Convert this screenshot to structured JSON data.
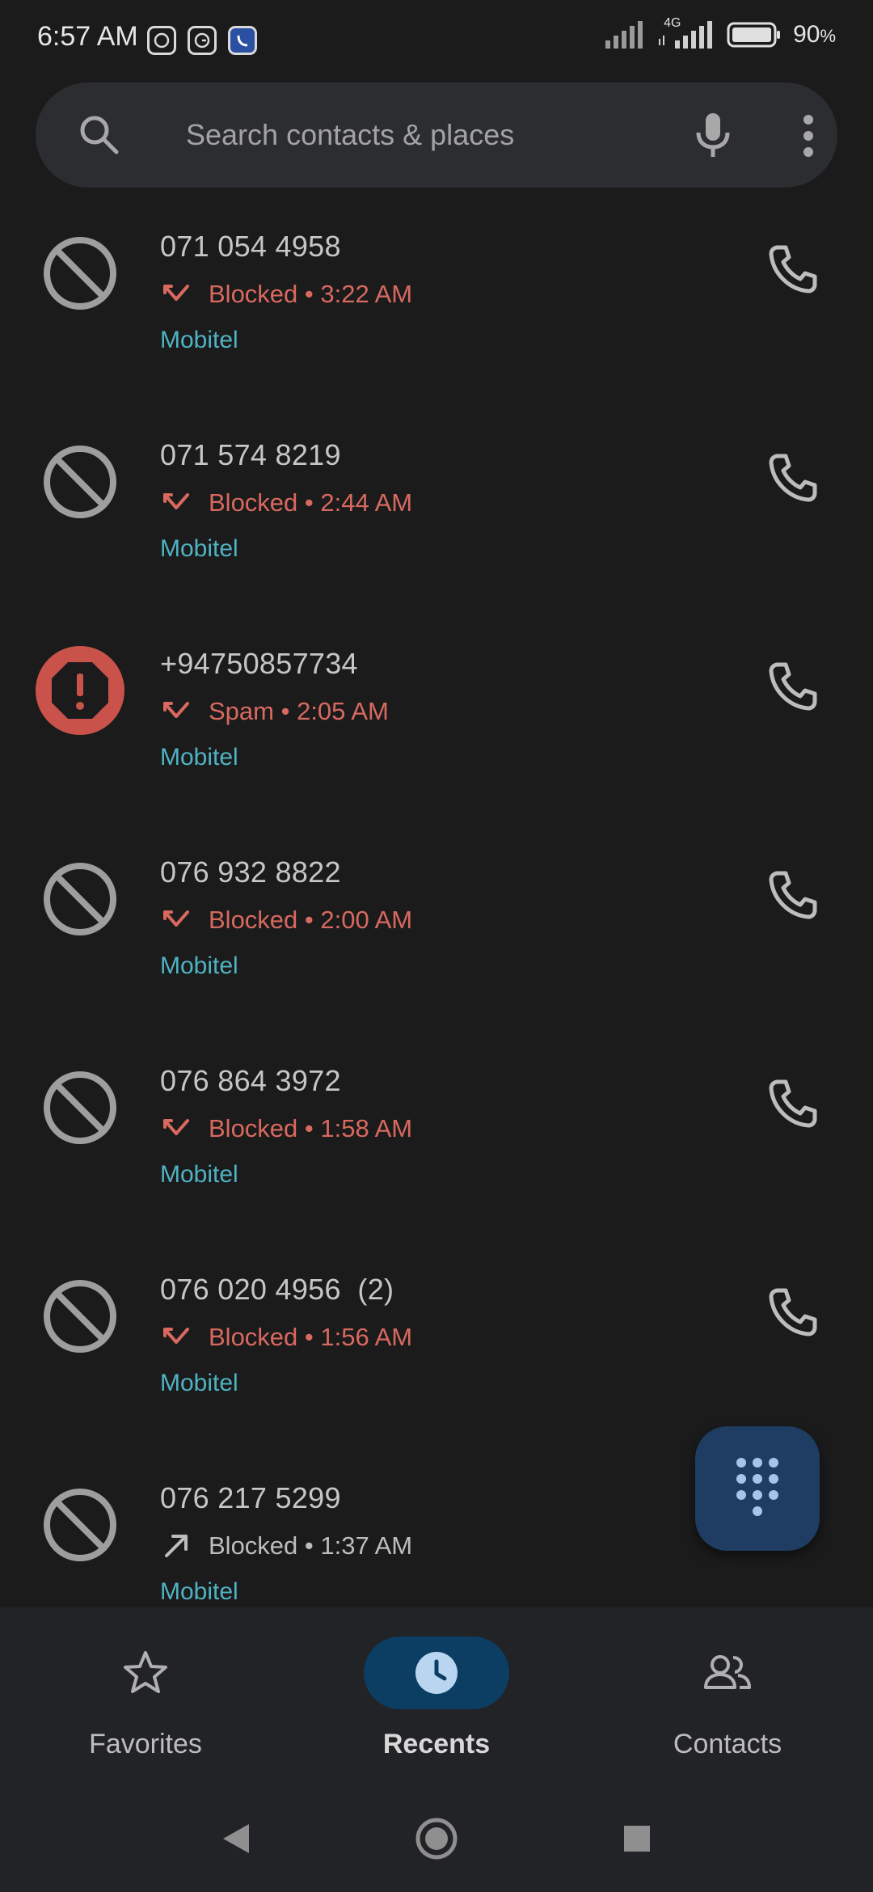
{
  "status_bar": {
    "time": "6:57 AM",
    "network": "4G",
    "battery": "90",
    "battery_unit": "%",
    "notification_icons": [
      "whatsapp-icon",
      "grammarly-icon",
      "app-icon"
    ]
  },
  "search": {
    "placeholder": "Search contacts & places"
  },
  "calls": [
    {
      "caller": "071 054 4958",
      "status": "Blocked",
      "time": "3:22 AM",
      "carrier": "Mobitel",
      "type": "blocked",
      "direction": "missed"
    },
    {
      "caller": "071 574 8219",
      "status": "Blocked",
      "time": "2:44 AM",
      "carrier": "Mobitel",
      "type": "blocked",
      "direction": "missed"
    },
    {
      "caller": "+94750857734",
      "status": "Spam",
      "time": "2:05 AM",
      "carrier": "Mobitel",
      "type": "spam",
      "direction": "missed"
    },
    {
      "caller": "076 932 8822",
      "status": "Blocked",
      "time": "2:00 AM",
      "carrier": "Mobitel",
      "type": "blocked",
      "direction": "missed"
    },
    {
      "caller": "076 864 3972",
      "status": "Blocked",
      "time": "1:58 AM",
      "carrier": "Mobitel",
      "type": "blocked",
      "direction": "missed"
    },
    {
      "caller": "076 020 4956  (2)",
      "status": "Blocked",
      "time": "1:56 AM",
      "carrier": "Mobitel",
      "type": "blocked",
      "direction": "missed"
    },
    {
      "caller": "076 217 5299",
      "status": "Blocked",
      "time": "1:37 AM",
      "carrier": "Mobitel",
      "type": "blocked",
      "direction": "outgoing"
    }
  ],
  "nav": {
    "favorites": "Favorites",
    "recents": "Recents",
    "contacts": "Contacts",
    "active": "recents"
  },
  "colors": {
    "background": "#1b1b1c",
    "missed_red": "#d9695f",
    "carrier_teal": "#4fb3c3",
    "spam_badge": "#c9534b",
    "active_nav": "#0c3d63",
    "fab": "#1f3d63"
  }
}
